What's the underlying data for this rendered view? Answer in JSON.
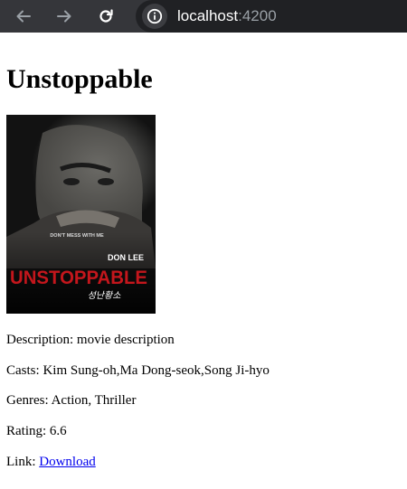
{
  "browser": {
    "url_host": "localhost",
    "url_port": ":4200",
    "icons": [
      "back-arrow-icon",
      "forward-arrow-icon",
      "reload-icon",
      "info-icon"
    ]
  },
  "movie": {
    "title": "Unstoppable",
    "poster": {
      "tagline": "DON'T MESS WITH ME",
      "actor_name": "DON LEE",
      "poster_title": "UNSTOPPABLE",
      "korean_title": "성난황소"
    },
    "description_label": "Description: ",
    "description": "movie description",
    "casts_label": "Casts: ",
    "casts": "Kim Sung-oh,Ma Dong-seok,Song Ji-hyo",
    "genres_label": "Genres: ",
    "genres": "Action, Thriller",
    "rating_label": "Rating: ",
    "rating": "6.6",
    "link_label": "Link: ",
    "link_text": "Download"
  },
  "colors": {
    "browser_bar": "#35363a",
    "omnibox": "#202124",
    "link": "#0000ee",
    "poster_red": "#c4161c"
  }
}
